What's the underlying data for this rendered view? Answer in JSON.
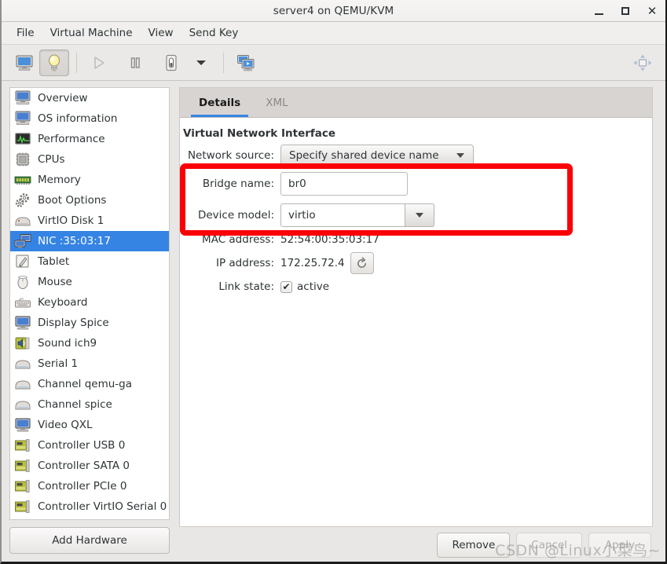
{
  "window": {
    "title": "server4 on QEMU/KVM",
    "controls": [
      {
        "name": "minimize-button",
        "label": "–"
      },
      {
        "name": "maximize-button",
        "label": "□"
      },
      {
        "name": "close-button",
        "label": "✕"
      }
    ]
  },
  "menubar": {
    "items": [
      {
        "label": "File"
      },
      {
        "label": "Virtual Machine"
      },
      {
        "label": "View"
      },
      {
        "label": "Send Key"
      }
    ]
  },
  "toolbar": {
    "buttons": [
      {
        "name": "show-console-button",
        "icon": "monitor-icon",
        "state": "normal"
      },
      {
        "name": "show-details-button",
        "icon": "lightbulb-icon",
        "state": "pressed"
      },
      {
        "name": "run-button",
        "icon": "play-icon",
        "state": "disabled"
      },
      {
        "name": "pause-button",
        "icon": "pause-icon",
        "state": "normal"
      },
      {
        "name": "shutdown-button",
        "icon": "power-icon",
        "state": "normal"
      },
      {
        "name": "shutdown-menu-button",
        "icon": "chevron-down-icon",
        "state": "normal"
      },
      {
        "name": "snapshots-button",
        "icon": "snapshots-icon",
        "state": "normal"
      }
    ],
    "fullscreen_icon": "fullscreen-icon"
  },
  "sidebar": {
    "add_hardware_label": "Add Hardware",
    "items": [
      {
        "label": "Overview",
        "icon": "computer-icon",
        "selected": false
      },
      {
        "label": "OS information",
        "icon": "computer-icon",
        "selected": false
      },
      {
        "label": "Performance",
        "icon": "performance-icon",
        "selected": false
      },
      {
        "label": "CPUs",
        "icon": "cpu-icon",
        "selected": false
      },
      {
        "label": "Memory",
        "icon": "memory-icon",
        "selected": false
      },
      {
        "label": "Boot Options",
        "icon": "gears-icon",
        "selected": false
      },
      {
        "label": "VirtIO Disk 1",
        "icon": "disk-icon",
        "selected": false
      },
      {
        "label": "NIC :35:03:17",
        "icon": "nic-icon",
        "selected": true
      },
      {
        "label": "Tablet",
        "icon": "tablet-icon",
        "selected": false
      },
      {
        "label": "Mouse",
        "icon": "mouse-icon",
        "selected": false
      },
      {
        "label": "Keyboard",
        "icon": "keyboard-icon",
        "selected": false
      },
      {
        "label": "Display Spice",
        "icon": "display-icon",
        "selected": false
      },
      {
        "label": "Sound ich9",
        "icon": "sound-icon",
        "selected": false
      },
      {
        "label": "Serial 1",
        "icon": "serial-icon",
        "selected": false
      },
      {
        "label": "Channel qemu-ga",
        "icon": "serial-icon",
        "selected": false
      },
      {
        "label": "Channel spice",
        "icon": "serial-icon",
        "selected": false
      },
      {
        "label": "Video QXL",
        "icon": "display-icon",
        "selected": false
      },
      {
        "label": "Controller USB 0",
        "icon": "controller-icon",
        "selected": false
      },
      {
        "label": "Controller SATA 0",
        "icon": "controller-icon",
        "selected": false
      },
      {
        "label": "Controller PCIe 0",
        "icon": "controller-icon",
        "selected": false
      },
      {
        "label": "Controller VirtIO Serial 0",
        "icon": "controller-icon",
        "selected": false
      }
    ]
  },
  "tabs": [
    {
      "label": "Details",
      "active": true
    },
    {
      "label": "XML",
      "active": false
    }
  ],
  "details": {
    "section_title": "Virtual Network Interface",
    "network_source": {
      "label": "Network source:",
      "value": "Specify shared device name"
    },
    "bridge_name": {
      "label": "Bridge name:",
      "value": "br0"
    },
    "device_model": {
      "label": "Device model:",
      "value": "virtio"
    },
    "mac_address": {
      "label": "MAC address:",
      "value": "52:54:00:35:03:17"
    },
    "ip_address": {
      "label": "IP address:",
      "value": "172.25.72.4",
      "refresh_icon": "refresh-icon"
    },
    "link_state": {
      "label": "Link state:",
      "value": "active",
      "checked": true,
      "check_glyph": "✔"
    }
  },
  "actions": [
    {
      "name": "remove-button",
      "label": "Remove",
      "disabled": false
    },
    {
      "name": "cancel-button",
      "label": "Cancel",
      "disabled": true
    },
    {
      "name": "apply-button",
      "label": "Apply",
      "disabled": true
    }
  ],
  "watermark": "CSDN @Linux小菜鸟~",
  "colors": {
    "accent": "#3584e4",
    "annotation": "#fb0007",
    "window_bg": "#f0efee",
    "panel_bg": "#ffffff"
  }
}
